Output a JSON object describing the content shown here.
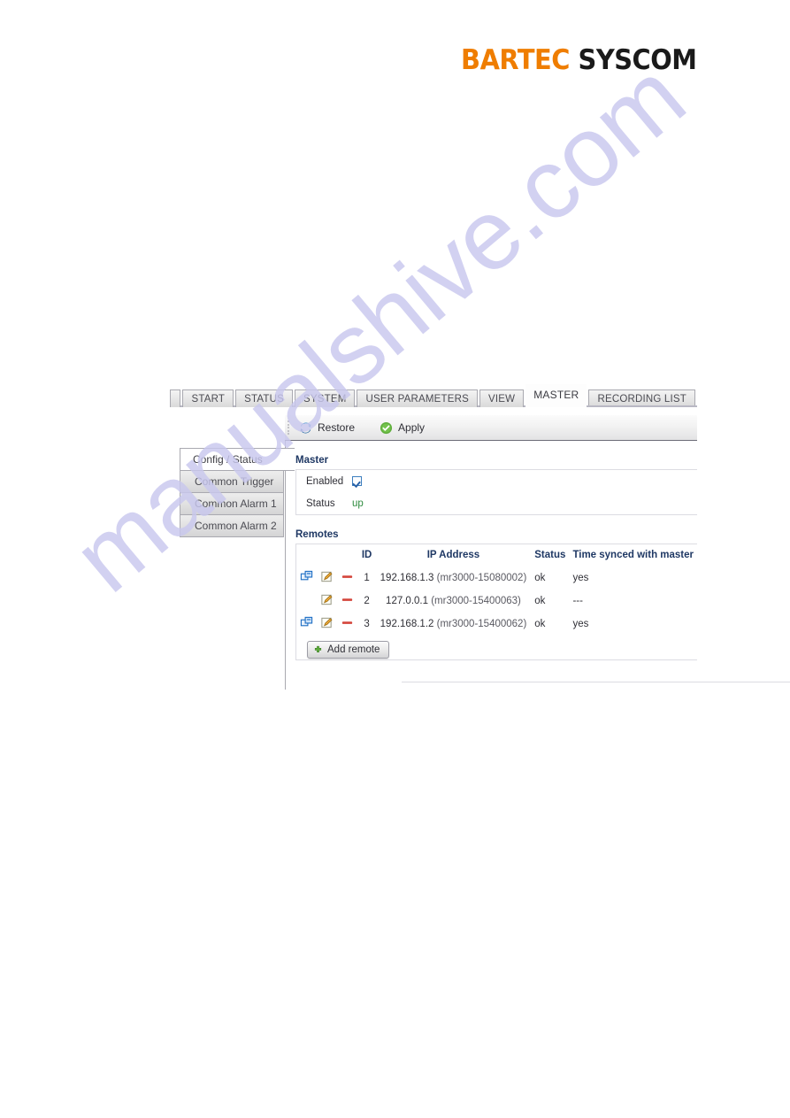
{
  "brand": {
    "part1": "BARTEC",
    "part2": "SYSCOM"
  },
  "watermark": {
    "text": "manualshive.com"
  },
  "main_tabs": [
    {
      "label": "",
      "name": "tab-blank",
      "active": false
    },
    {
      "label": "START",
      "name": "tab-start",
      "active": false
    },
    {
      "label": "STATUS",
      "name": "tab-status",
      "active": false
    },
    {
      "label": "SYSTEM",
      "name": "tab-system",
      "active": false
    },
    {
      "label": "USER PARAMETERS",
      "name": "tab-user-parameters",
      "active": false
    },
    {
      "label": "VIEW",
      "name": "tab-view",
      "active": false
    },
    {
      "label": "MASTER",
      "name": "tab-master",
      "active": true
    },
    {
      "label": "RECORDING LIST",
      "name": "tab-recording-list",
      "active": false
    }
  ],
  "toolbar": {
    "restore_label": "Restore",
    "restore_icon": "refresh-icon",
    "apply_label": "Apply",
    "apply_icon": "check-circle-icon"
  },
  "side_tabs": [
    {
      "label": "Config / Status",
      "active": true
    },
    {
      "label": "Common Trigger",
      "active": false
    },
    {
      "label": "Common Alarm 1",
      "active": false
    },
    {
      "label": "Common Alarm 2",
      "active": false
    }
  ],
  "master": {
    "title": "Master",
    "enabled_label": "Enabled",
    "enabled_checked": true,
    "status_label": "Status",
    "status_value": "up",
    "status_color": "#2e8b3e"
  },
  "remotes": {
    "title": "Remotes",
    "columns": [
      "",
      "",
      "",
      "ID",
      "IP Address",
      "Status",
      "Time synced with master"
    ],
    "rows": [
      {
        "connect_icon": "remote-desktop-icon",
        "has_connect": true,
        "edit_icon": "edit-pencil-icon",
        "delete_icon": "remove-minus-icon",
        "id": "1",
        "ip": "192.168.1.3",
        "serial": "(mr3000-15080002)",
        "status": "ok",
        "synced": "yes"
      },
      {
        "connect_icon": "remote-desktop-icon",
        "has_connect": false,
        "edit_icon": "edit-pencil-icon",
        "delete_icon": "remove-minus-icon",
        "id": "2",
        "ip": "127.0.0.1",
        "serial": "(mr3000-15400063)",
        "status": "ok",
        "synced": "---"
      },
      {
        "connect_icon": "remote-desktop-icon",
        "has_connect": true,
        "edit_icon": "edit-pencil-icon",
        "delete_icon": "remove-minus-icon",
        "id": "3",
        "ip": "192.168.1.2",
        "serial": "(mr3000-15400062)",
        "status": "ok",
        "synced": "yes"
      }
    ],
    "add_button_label": "Add remote",
    "add_button_icon": "plus-icon"
  },
  "colors": {
    "brand_orange": "#ef7d00",
    "brand_black": "#1a1a1a",
    "heading_navy": "#1f3864",
    "status_green": "#2e8b3e",
    "watermark": "#c9c8ee",
    "delete_red": "#d4453b",
    "connect_blue": "#1f6fc4"
  }
}
